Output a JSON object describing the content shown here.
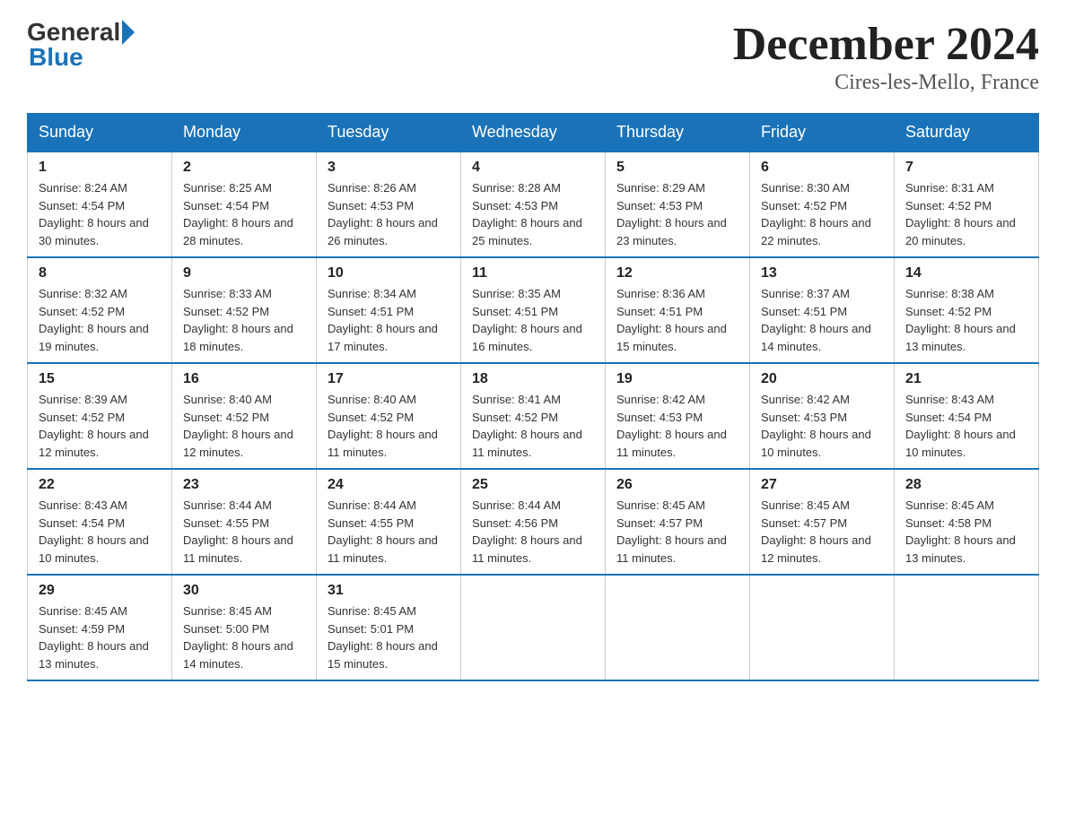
{
  "header": {
    "logo_general": "General",
    "logo_blue": "Blue",
    "month_title": "December 2024",
    "location": "Cires-les-Mello, France"
  },
  "weekdays": [
    "Sunday",
    "Monday",
    "Tuesday",
    "Wednesday",
    "Thursday",
    "Friday",
    "Saturday"
  ],
  "weeks": [
    [
      {
        "day": "1",
        "sunrise": "8:24 AM",
        "sunset": "4:54 PM",
        "daylight": "8 hours and 30 minutes."
      },
      {
        "day": "2",
        "sunrise": "8:25 AM",
        "sunset": "4:54 PM",
        "daylight": "8 hours and 28 minutes."
      },
      {
        "day": "3",
        "sunrise": "8:26 AM",
        "sunset": "4:53 PM",
        "daylight": "8 hours and 26 minutes."
      },
      {
        "day": "4",
        "sunrise": "8:28 AM",
        "sunset": "4:53 PM",
        "daylight": "8 hours and 25 minutes."
      },
      {
        "day": "5",
        "sunrise": "8:29 AM",
        "sunset": "4:53 PM",
        "daylight": "8 hours and 23 minutes."
      },
      {
        "day": "6",
        "sunrise": "8:30 AM",
        "sunset": "4:52 PM",
        "daylight": "8 hours and 22 minutes."
      },
      {
        "day": "7",
        "sunrise": "8:31 AM",
        "sunset": "4:52 PM",
        "daylight": "8 hours and 20 minutes."
      }
    ],
    [
      {
        "day": "8",
        "sunrise": "8:32 AM",
        "sunset": "4:52 PM",
        "daylight": "8 hours and 19 minutes."
      },
      {
        "day": "9",
        "sunrise": "8:33 AM",
        "sunset": "4:52 PM",
        "daylight": "8 hours and 18 minutes."
      },
      {
        "day": "10",
        "sunrise": "8:34 AM",
        "sunset": "4:51 PM",
        "daylight": "8 hours and 17 minutes."
      },
      {
        "day": "11",
        "sunrise": "8:35 AM",
        "sunset": "4:51 PM",
        "daylight": "8 hours and 16 minutes."
      },
      {
        "day": "12",
        "sunrise": "8:36 AM",
        "sunset": "4:51 PM",
        "daylight": "8 hours and 15 minutes."
      },
      {
        "day": "13",
        "sunrise": "8:37 AM",
        "sunset": "4:51 PM",
        "daylight": "8 hours and 14 minutes."
      },
      {
        "day": "14",
        "sunrise": "8:38 AM",
        "sunset": "4:52 PM",
        "daylight": "8 hours and 13 minutes."
      }
    ],
    [
      {
        "day": "15",
        "sunrise": "8:39 AM",
        "sunset": "4:52 PM",
        "daylight": "8 hours and 12 minutes."
      },
      {
        "day": "16",
        "sunrise": "8:40 AM",
        "sunset": "4:52 PM",
        "daylight": "8 hours and 12 minutes."
      },
      {
        "day": "17",
        "sunrise": "8:40 AM",
        "sunset": "4:52 PM",
        "daylight": "8 hours and 11 minutes."
      },
      {
        "day": "18",
        "sunrise": "8:41 AM",
        "sunset": "4:52 PM",
        "daylight": "8 hours and 11 minutes."
      },
      {
        "day": "19",
        "sunrise": "8:42 AM",
        "sunset": "4:53 PM",
        "daylight": "8 hours and 11 minutes."
      },
      {
        "day": "20",
        "sunrise": "8:42 AM",
        "sunset": "4:53 PM",
        "daylight": "8 hours and 10 minutes."
      },
      {
        "day": "21",
        "sunrise": "8:43 AM",
        "sunset": "4:54 PM",
        "daylight": "8 hours and 10 minutes."
      }
    ],
    [
      {
        "day": "22",
        "sunrise": "8:43 AM",
        "sunset": "4:54 PM",
        "daylight": "8 hours and 10 minutes."
      },
      {
        "day": "23",
        "sunrise": "8:44 AM",
        "sunset": "4:55 PM",
        "daylight": "8 hours and 11 minutes."
      },
      {
        "day": "24",
        "sunrise": "8:44 AM",
        "sunset": "4:55 PM",
        "daylight": "8 hours and 11 minutes."
      },
      {
        "day": "25",
        "sunrise": "8:44 AM",
        "sunset": "4:56 PM",
        "daylight": "8 hours and 11 minutes."
      },
      {
        "day": "26",
        "sunrise": "8:45 AM",
        "sunset": "4:57 PM",
        "daylight": "8 hours and 11 minutes."
      },
      {
        "day": "27",
        "sunrise": "8:45 AM",
        "sunset": "4:57 PM",
        "daylight": "8 hours and 12 minutes."
      },
      {
        "day": "28",
        "sunrise": "8:45 AM",
        "sunset": "4:58 PM",
        "daylight": "8 hours and 13 minutes."
      }
    ],
    [
      {
        "day": "29",
        "sunrise": "8:45 AM",
        "sunset": "4:59 PM",
        "daylight": "8 hours and 13 minutes."
      },
      {
        "day": "30",
        "sunrise": "8:45 AM",
        "sunset": "5:00 PM",
        "daylight": "8 hours and 14 minutes."
      },
      {
        "day": "31",
        "sunrise": "8:45 AM",
        "sunset": "5:01 PM",
        "daylight": "8 hours and 15 minutes."
      },
      null,
      null,
      null,
      null
    ]
  ],
  "labels": {
    "sunrise": "Sunrise:",
    "sunset": "Sunset:",
    "daylight": "Daylight:"
  }
}
